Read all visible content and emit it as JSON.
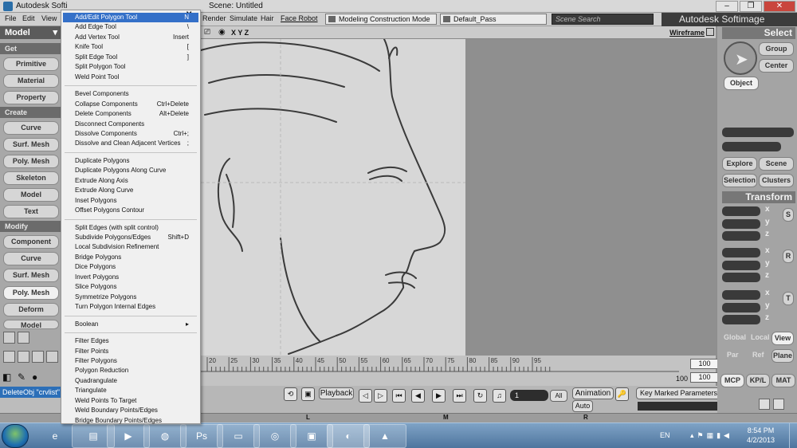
{
  "window": {
    "app_title": "Autodesk Softi",
    "scene_title": "Scene: Untitled",
    "min": "–",
    "max": "❐",
    "close": "✕"
  },
  "menubar": {
    "items": [
      "File",
      "Edit",
      "View"
    ],
    "right_items": [
      "Render",
      "Simulate",
      "Hair",
      "Face Robot"
    ],
    "mode": "Modeling Construction Mode",
    "pass": "Default_Pass",
    "search_placeholder": "Scene Search",
    "brand": "Autodesk Softimage"
  },
  "left_toolbar": {
    "model_label": "Model",
    "get_header": "Get",
    "get_buttons": [
      "Primitive",
      "Material",
      "Property"
    ],
    "create_header": "Create",
    "create_buttons": [
      "Curve",
      "Surf. Mesh",
      "Poly. Mesh",
      "Skeleton",
      "Model",
      "Text"
    ],
    "modify_header": "Modify",
    "modify_buttons": [
      "Component",
      "Curve",
      "Surf. Mesh",
      "Poly. Mesh",
      "Deform",
      "Model"
    ]
  },
  "viewport": {
    "axes": "X Y Z",
    "shading": "Wireframe"
  },
  "context_menu": {
    "close": "✕",
    "groups": [
      [
        {
          "label": "Add/Edit Polygon Tool",
          "shortcut": "N",
          "highlighted": true
        },
        {
          "label": "Add Edge Tool",
          "shortcut": "\\"
        },
        {
          "label": "Add Vertex Tool",
          "shortcut": "Insert"
        },
        {
          "label": "Knife Tool",
          "shortcut": "["
        },
        {
          "label": "Split Edge Tool",
          "shortcut": "]"
        },
        {
          "label": "Split Polygon Tool",
          "shortcut": ""
        },
        {
          "label": "Weld Point Tool",
          "shortcut": ""
        }
      ],
      [
        {
          "label": "Bevel Components",
          "shortcut": ""
        },
        {
          "label": "Collapse Components",
          "shortcut": "Ctrl+Delete"
        },
        {
          "label": "Delete Components",
          "shortcut": "Alt+Delete"
        },
        {
          "label": "Disconnect Components",
          "shortcut": ""
        },
        {
          "label": "Dissolve Components",
          "shortcut": "Ctrl+;"
        },
        {
          "label": "Dissolve and Clean Adjacent Vertices",
          "shortcut": ";"
        }
      ],
      [
        {
          "label": "Duplicate Polygons",
          "shortcut": ""
        },
        {
          "label": "Duplicate Polygons Along Curve",
          "shortcut": ""
        },
        {
          "label": "Extrude Along Axis",
          "shortcut": ""
        },
        {
          "label": "Extrude Along Curve",
          "shortcut": ""
        },
        {
          "label": "Inset Polygons",
          "shortcut": ""
        },
        {
          "label": "Offset Polygons Contour",
          "shortcut": ""
        }
      ],
      [
        {
          "label": "Split Edges (with split control)",
          "shortcut": ""
        },
        {
          "label": "Subdivide Polygons/Edges",
          "shortcut": "Shift+D"
        },
        {
          "label": "Local Subdivision Refinement",
          "shortcut": ""
        },
        {
          "label": "Bridge Polygons",
          "shortcut": ""
        },
        {
          "label": "Dice Polygons",
          "shortcut": ""
        },
        {
          "label": "Invert Polygons",
          "shortcut": ""
        },
        {
          "label": "Slice Polygons",
          "shortcut": ""
        },
        {
          "label": "Symmetrize Polygons",
          "shortcut": ""
        },
        {
          "label": "Turn Polygon Internal Edges",
          "shortcut": ""
        }
      ],
      [
        {
          "label": "Boolean",
          "shortcut": "▸"
        }
      ],
      [
        {
          "label": "Filter Edges",
          "shortcut": ""
        },
        {
          "label": "Filter Points",
          "shortcut": ""
        },
        {
          "label": "Filter Polygons",
          "shortcut": ""
        },
        {
          "label": "Polygon Reduction",
          "shortcut": ""
        },
        {
          "label": "Quadrangulate",
          "shortcut": ""
        },
        {
          "label": "Triangulate",
          "shortcut": ""
        },
        {
          "label": "Weld Points To Target",
          "shortcut": ""
        },
        {
          "label": "Weld Boundary Points/Edges",
          "shortcut": ""
        },
        {
          "label": "Bridge Boundary Points/Edges",
          "shortcut": ""
        }
      ]
    ]
  },
  "timeline": {
    "ticks": [
      "20",
      "25",
      "30",
      "35",
      "40",
      "45",
      "50",
      "55",
      "60",
      "65",
      "70",
      "75",
      "80",
      "85",
      "90",
      "95"
    ],
    "end_frame": "100",
    "end_frame2": "100",
    "start_frame2": "100"
  },
  "playback": {
    "label": "Playback",
    "current_frame": "1",
    "all": "All",
    "animation": "Animation",
    "auto": "Auto",
    "key_marked": "Key Marked Parameters"
  },
  "right_panel": {
    "select_header": "Select",
    "group": "Group",
    "center": "Center",
    "object": "Object",
    "explore": "Explore",
    "scene": "Scene",
    "selection": "Selection",
    "clusters": "Clusters",
    "transform_header": "Transform",
    "axes": [
      "x",
      "y",
      "z"
    ],
    "srt": [
      "S",
      "R",
      "T"
    ],
    "global": "Global",
    "local": "Local",
    "view": "View",
    "par": "Par",
    "ref": "Ref",
    "plane": "Plane",
    "mcp": "MCP",
    "kpl": "KP/L",
    "mat": "MAT"
  },
  "command_line": "DeleteObj \"crvlist\"",
  "lmr": [
    "L",
    "M",
    "R"
  ],
  "taskbar": {
    "lang": "EN",
    "time": "8:54 PM",
    "date": "4/2/2013",
    "apps": [
      "folder",
      "media-player",
      "firefox",
      "photoshop",
      "notepad",
      "softimage-alt",
      "photo-viewer",
      "softimage",
      "vlc"
    ]
  }
}
